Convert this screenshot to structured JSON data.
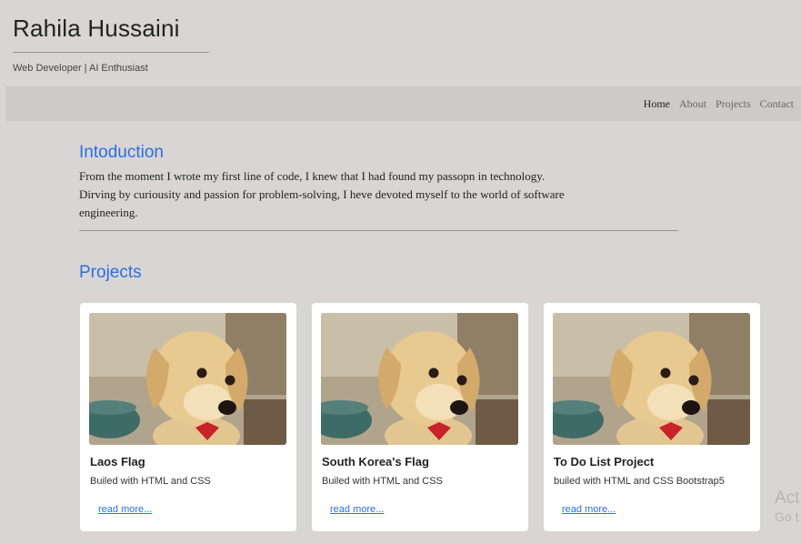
{
  "header": {
    "title": "Rahila Hussaini",
    "tagline": "Web Developer | AI Enthusiast"
  },
  "nav": {
    "items": [
      {
        "label": "Home",
        "active": true
      },
      {
        "label": "About"
      },
      {
        "label": "Projects"
      },
      {
        "label": "Contact"
      }
    ]
  },
  "intro": {
    "heading": "Intoduction",
    "lines": [
      "From the moment I wrote my first line of code, I knew that I had found my passopn in technology.",
      "Dirving by curiousity and passion for problem-solving, I heve devoted myself to the world of software",
      "engineering."
    ]
  },
  "projects": {
    "heading": "Projects",
    "cards": [
      {
        "title": "Laos Flag",
        "description": "Builed with HTML and CSS",
        "link": "read more...",
        "image": "puppy-photo"
      },
      {
        "title": "South Korea's Flag",
        "description": "Builed with HTML and CSS",
        "link": "read more...",
        "image": "puppy-photo"
      },
      {
        "title": "To Do List Project",
        "description": "builed with HTML and CSS Bootstrap5",
        "link": "read more...",
        "image": "puppy-photo"
      }
    ]
  },
  "watermark": {
    "line1": "Act",
    "line2": "Go t"
  },
  "colors": {
    "accent": "#2c6fe0",
    "background": "#d9d5d5",
    "navbar": "#cfcaca",
    "card": "#ffffff"
  }
}
